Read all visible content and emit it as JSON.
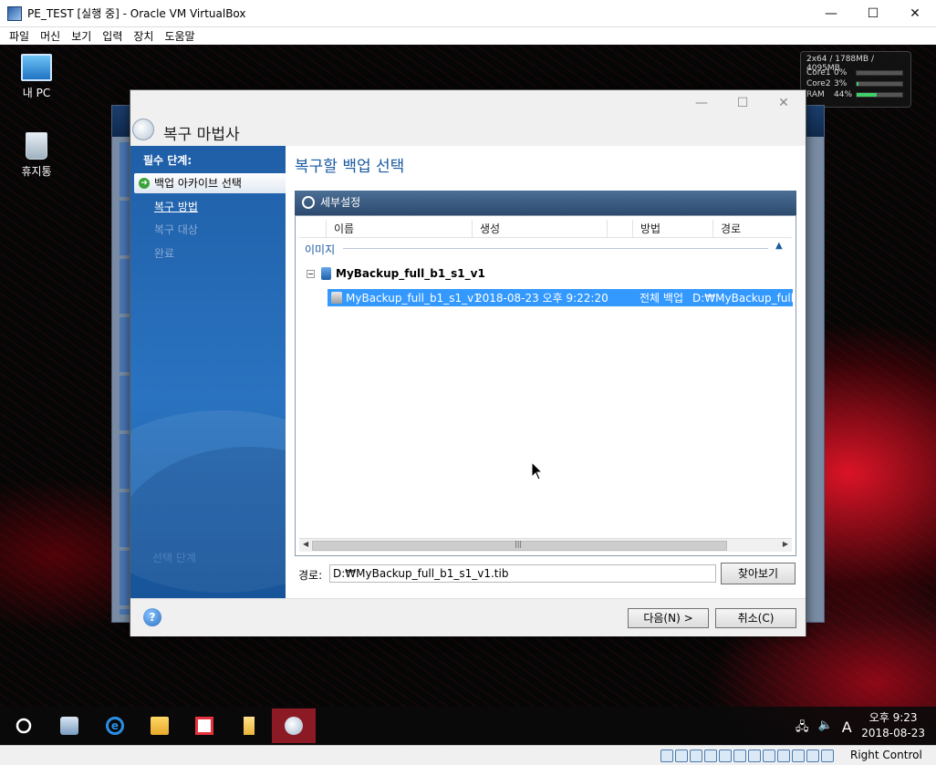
{
  "host": {
    "title": "PE_TEST [실행 중] - Oracle VM VirtualBox",
    "menu": [
      "파일",
      "머신",
      "보기",
      "입력",
      "장치",
      "도움말"
    ],
    "minimize": "—",
    "maximize": "☐",
    "close": "✕",
    "status_right_control": "Right Control"
  },
  "desktop": {
    "icons": [
      {
        "label": "내 PC",
        "icon": "this-pc-icon"
      },
      {
        "label": "휴지통",
        "icon": "recycle-bin-icon"
      }
    ]
  },
  "sysmon": {
    "header": "2x64 / 1788MB / 4095MB",
    "rows": [
      {
        "label": "Core1",
        "pct": "0%",
        "value": 0
      },
      {
        "label": "Core2",
        "pct": "3%",
        "value": 3
      },
      {
        "label": "RAM",
        "pct": "44%",
        "value": 44
      }
    ]
  },
  "wizard": {
    "title": "복구 마법사",
    "sidebar": {
      "heading": "필수 단계:",
      "steps": [
        {
          "label": "백업 아카이브 선택",
          "state": "active"
        },
        {
          "label": "복구 방법",
          "state": "link"
        },
        {
          "label": "복구 대상",
          "state": "disabled"
        },
        {
          "label": "완료",
          "state": "disabled"
        }
      ],
      "faded": "선택 단계"
    },
    "main": {
      "heading": "복구할 백업 선택",
      "panel_title": "세부설정",
      "columns": [
        "이름",
        "생성",
        "방법",
        "경로"
      ],
      "group": "이미지",
      "archive": "MyBackup_full_b1_s1_v1",
      "row": {
        "name": "MyBackup_full_b1_s1_v1",
        "created": "2018-08-23 오후 9:22:20",
        "method": "전체 백업",
        "path": "D:₩MyBackup_full_b"
      },
      "path_label": "경로:",
      "path_value": "D:₩MyBackup_full_b1_s1_v1.tib",
      "browse": "찾아보기"
    },
    "footer": {
      "help": "?",
      "next": "다음(N) >",
      "cancel": "취소(C)"
    }
  },
  "taskbar": {
    "time": "오후 9:23",
    "date": "2018-08-23",
    "ime": "A"
  }
}
